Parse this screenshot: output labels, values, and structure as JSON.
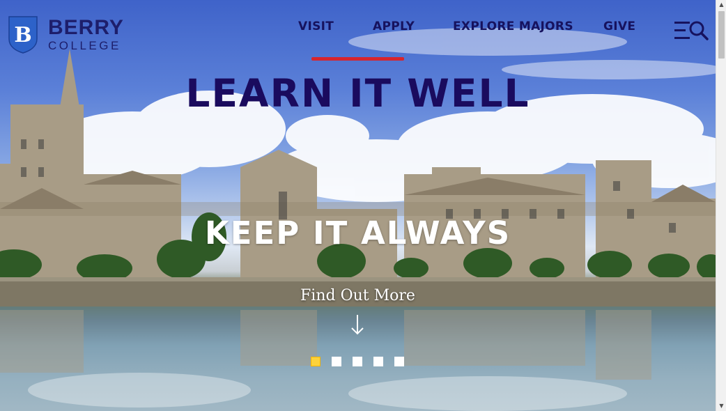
{
  "brand": {
    "name_line1": "BERRY",
    "name_line2": "COLLEGE",
    "shield_letter": "B"
  },
  "nav": [
    {
      "label": "VISIT"
    },
    {
      "label": "APPLY"
    },
    {
      "label": "EXPLORE MAJORS"
    },
    {
      "label": "GIVE"
    }
  ],
  "icons": {
    "menu": "hamburger-menu-icon",
    "search": "search-icon",
    "scroll_down": "arrow-down-icon"
  },
  "hero": {
    "headline": "LEARN IT WELL",
    "subline": "KEEP IT ALWAYS",
    "cta_label": "Find Out More",
    "slides": {
      "count": 5,
      "active_index": 0
    }
  },
  "colors": {
    "navy": "#1a0b5e",
    "accent_red": "#d7252d",
    "dot_active": "#fdd23a",
    "shield_blue": "#2d62c9"
  }
}
